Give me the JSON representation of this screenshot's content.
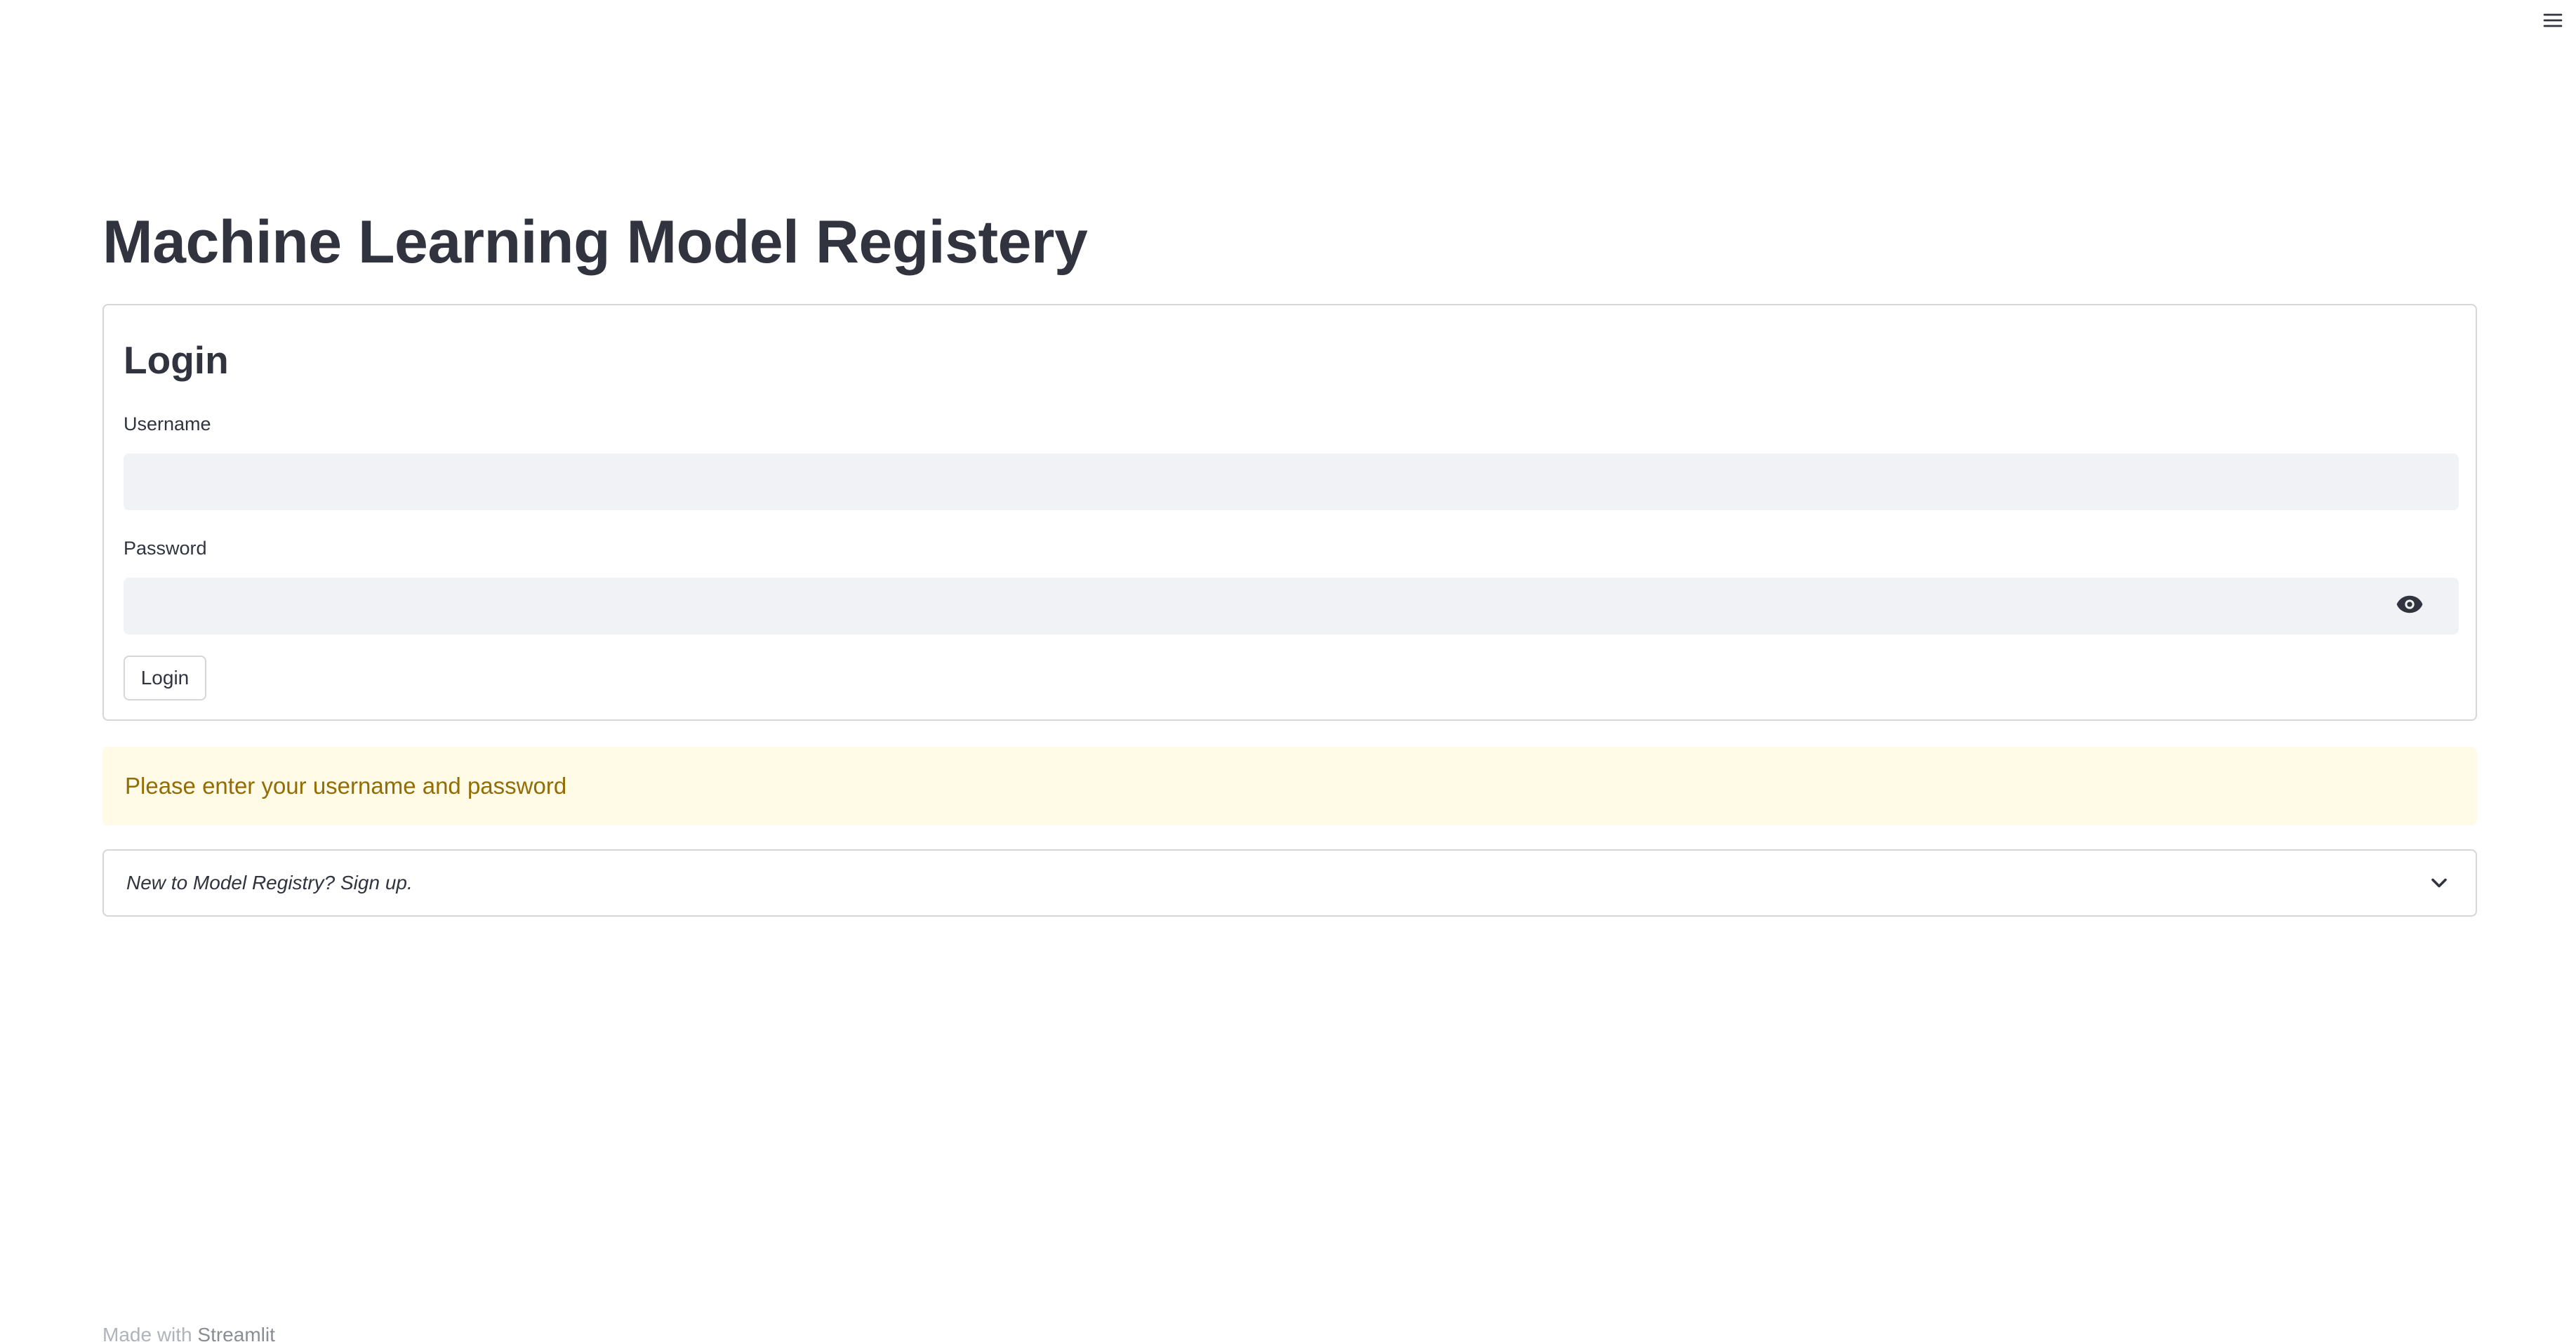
{
  "header": {
    "menu_icon": "hamburger-menu-icon"
  },
  "page": {
    "title": "Machine Learning Model Registery"
  },
  "login_form": {
    "heading": "Login",
    "username": {
      "label": "Username",
      "value": "",
      "placeholder": ""
    },
    "password": {
      "label": "Password",
      "value": "",
      "placeholder": "",
      "toggle_icon": "eye-icon"
    },
    "submit_label": "Login"
  },
  "alert": {
    "type": "warning",
    "text": "Please enter your username and password",
    "background_color": "#fffbe6",
    "text_color": "#926c05"
  },
  "expander": {
    "label": "New to Model Registry? Sign up.",
    "icon": "chevron-down-icon",
    "expanded": false
  },
  "footer": {
    "prefix": "Made with ",
    "link_text": "Streamlit"
  },
  "colors": {
    "text": "#31333f",
    "input_background": "#f0f2f6",
    "border": "#d6d6d9"
  }
}
